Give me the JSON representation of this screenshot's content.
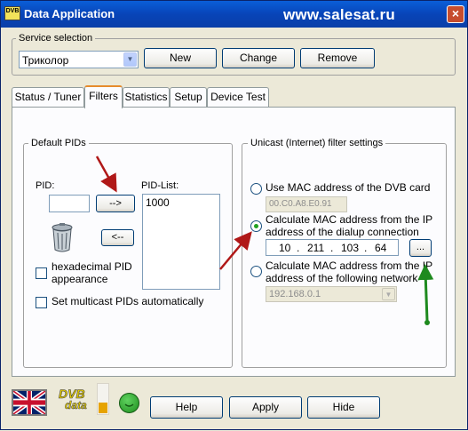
{
  "app": {
    "icon_text": "DVB",
    "title": "Data Application",
    "watermark": "www.salesat.ru",
    "close_glyph": "×"
  },
  "service": {
    "legend": "Service selection",
    "selected": "Триколор",
    "new_label": "New",
    "change_label": "Change",
    "remove_label": "Remove"
  },
  "tabs": [
    {
      "label": "Status / Tuner"
    },
    {
      "label": "Filters"
    },
    {
      "label": "Statistics"
    },
    {
      "label": "Setup"
    },
    {
      "label": "Device Test"
    }
  ],
  "default_pids": {
    "legend": "Default PIDs",
    "pid_label": "PID:",
    "pid_value": "",
    "add_arrow": "-->",
    "remove_arrow": "<--",
    "pid_list_label": "PID-List:",
    "pid_list": [
      "1000"
    ],
    "hex_label_1": "hexadecimal PID",
    "hex_label_2": "appearance",
    "multicast_label": "Set multicast PIDs automatically"
  },
  "unicast": {
    "legend": "Unicast (Internet) filter settings",
    "opt_mac_label": "Use MAC address of the DVB card",
    "mac_value": "00.C0.A8.E0.91",
    "opt_dialup_label_1": "Calculate MAC address from the IP",
    "opt_dialup_label_2": "address of the dialup connection",
    "ip": [
      "10",
      "211",
      "103",
      "64"
    ],
    "browse_label": "...",
    "opt_net_label_1": "Calculate MAC address from the IP",
    "opt_net_label_2": "address of the following network card",
    "net_value": "192.168.0.1"
  },
  "bottom": {
    "logo_text_1": "DVB",
    "logo_text_2": "data",
    "help_label": "Help",
    "apply_label": "Apply",
    "hide_label": "Hide"
  },
  "colors": {
    "annotation_red": "#b01818",
    "annotation_green": "#1e8a1e",
    "status_green": "#2faa2f"
  }
}
